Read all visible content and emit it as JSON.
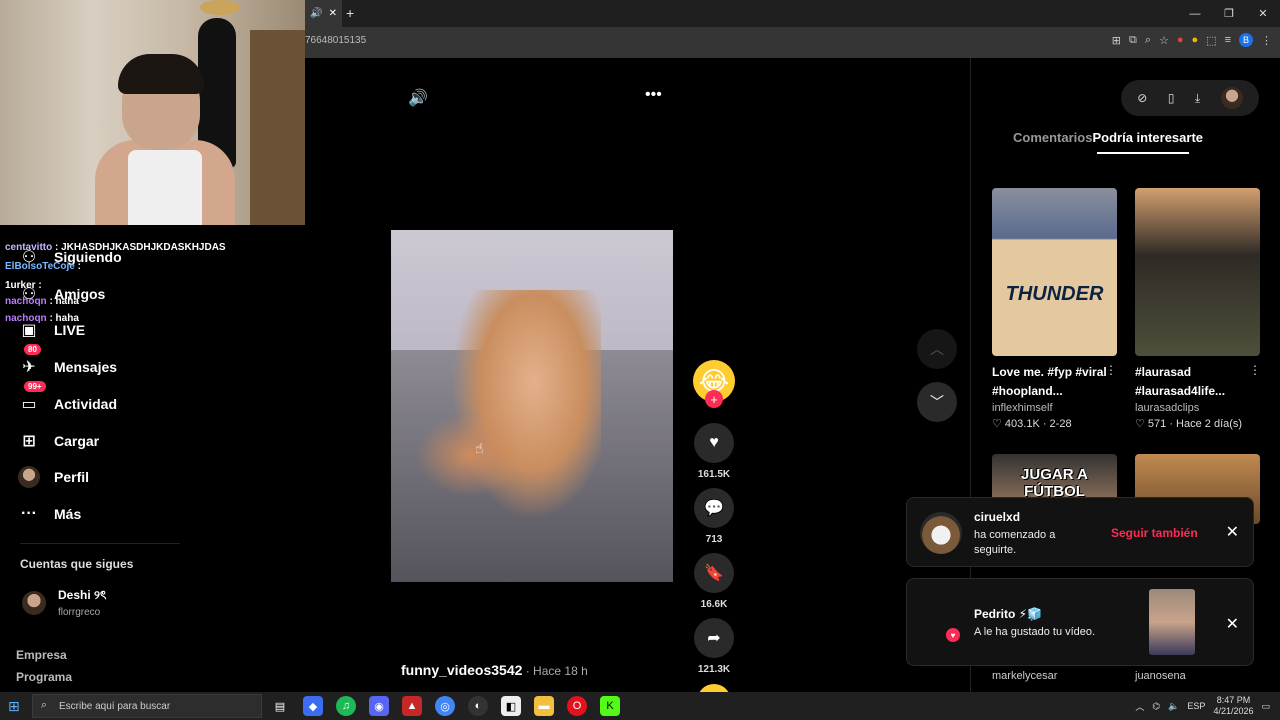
{
  "browser": {
    "url_fragment": "76648015135",
    "tab_close": "✕",
    "new_tab": "+",
    "window_controls": [
      "—",
      "❐",
      "✕"
    ],
    "profile_initial": "B"
  },
  "chat": [
    {
      "user": "centavitto",
      "text": " : JKHASDHJKASDHJKDASKHJDAS"
    },
    {
      "user": "ElBolsoTeCoje",
      "text": " :"
    },
    {
      "user": "1urker",
      "text": " :"
    },
    {
      "user": "nachoqn",
      "text": " : haha"
    },
    {
      "user": "nachoqn",
      "text": " : haha"
    }
  ],
  "nav": {
    "siguiendo": "Siguiendo",
    "amigos": "Amigos",
    "live": "LIVE",
    "mensajes": "Mensajes",
    "mensajes_badge": "80",
    "actividad": "Actividad",
    "actividad_badge": "99+",
    "cargar": "Cargar",
    "perfil": "Perfil",
    "mas": "Más",
    "following_title": "Cuentas que sigues",
    "account_name": "Deshi ୨ৎ",
    "account_handle": "florrgreco",
    "footer1": "Empresa",
    "footer2": "Programa"
  },
  "video": {
    "author": "funny_videos3542",
    "time": " · Hace 18 h",
    "likes": "161.5K",
    "comments": "713",
    "saves": "16.6K",
    "shares": "121.3K",
    "creator_emoji": "😂"
  },
  "panel": {
    "tab_comments": "Comentarios",
    "tab_interest": "Podría interesarte",
    "cards": [
      {
        "title": "Love me. #fyp #viral #hoopland...",
        "author": "inflexhimself",
        "meta": "♡ 403.1K · 2-28",
        "thumb_text": "THUNDER"
      },
      {
        "title": "#laurasad #laurasad4life...",
        "author": "laurasadclips",
        "meta": "♡ 571 · Hace 2 día(s)",
        "thumb_text": ""
      },
      {
        "thumb_text": "JUGAR A FÚTBOL"
      },
      {
        "thumb_text": ""
      }
    ],
    "bottom_authors": [
      "markelycesar",
      "juanosena"
    ]
  },
  "notifications": [
    {
      "name": "ciruelxd",
      "text": "ha comenzado a seguirte.",
      "action": "Seguir también"
    },
    {
      "name": "Pedrito ⚡🧊",
      "text": "A le ha gustado tu vídeo."
    }
  ],
  "taskbar": {
    "search_placeholder": "Escribe aquí para buscar",
    "lang": "ESP",
    "time": "8:47 PM",
    "date": "4/21/2026"
  },
  "colors": {
    "accent": "#fe2c55",
    "background": "#000000"
  }
}
